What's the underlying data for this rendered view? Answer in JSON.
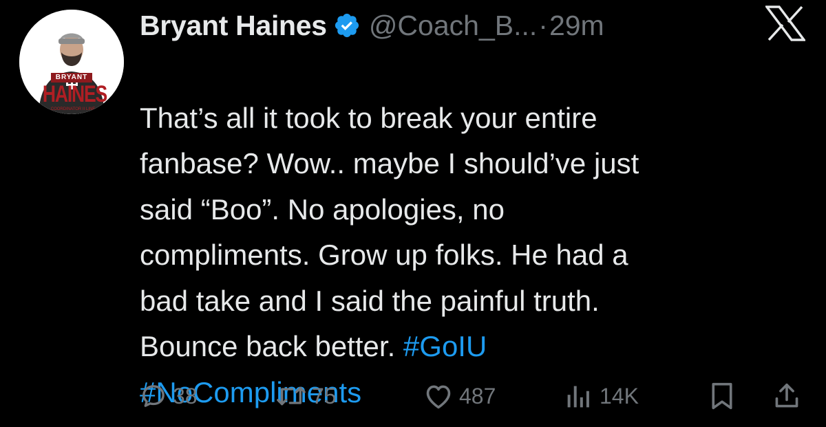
{
  "author": {
    "display_name": "Bryant Haines",
    "handle": "@Coach_B...",
    "time_separator": "·",
    "time": "29m",
    "avatar_text": {
      "top": "BRYANT",
      "main": "HAINES",
      "sub": "COORDINATOR II LINE"
    }
  },
  "tweet": {
    "segments": [
      {
        "text": "That’s all it took to break your entire\nfanbase?   Wow.. maybe I should’ve just\nsaid “Boo”.   No apologies, no\ncompliments.   Grow up folks.   He had a\nbad take and I said the painful truth.\nBounce back better.   ",
        "type": "text"
      },
      {
        "text": "#GoIU",
        "type": "hashtag"
      },
      {
        "text": "\n",
        "type": "text"
      },
      {
        "text": "#NoCompliments",
        "type": "hashtag"
      }
    ]
  },
  "actions": {
    "replies": "38",
    "reposts": "75",
    "likes": "487",
    "views": "14K"
  },
  "icons": {
    "reply": "speech-bubble-icon",
    "repost": "repost-arrows-icon",
    "like": "heart-icon",
    "views": "bar-chart-icon",
    "bookmark": "bookmark-icon",
    "share": "share-upload-icon",
    "brand": "x-logo-icon",
    "verified": "verified-badge-icon"
  },
  "colors": {
    "background": "#000000",
    "text": "#e7e9ea",
    "muted": "#71767b",
    "link": "#1d9bf0",
    "verified": "#1d9bf0",
    "avatar_accent": "#b01e23"
  }
}
